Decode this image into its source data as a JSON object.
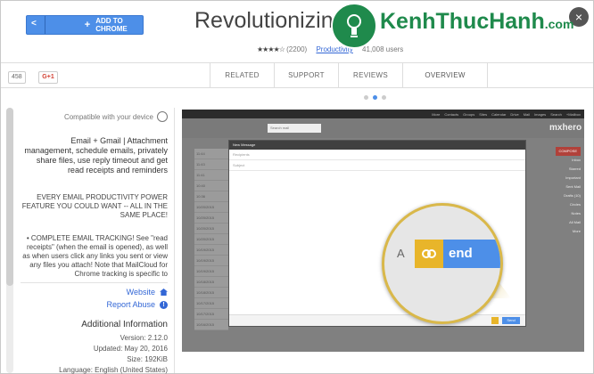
{
  "header": {
    "title": "Revolutionizing...",
    "add_button_label": "ADD TO CHROME",
    "rating_count": "(2200)",
    "category": "Productivity",
    "users": "41,008 users"
  },
  "share": {
    "count": "458",
    "gplus_label": "G+1"
  },
  "tabs": [
    "OVERVIEW",
    "REVIEWS",
    "SUPPORT",
    "RELATED"
  ],
  "sidebar": {
    "compatible": "Compatible with your device",
    "desc_main": "Email + Gmail | Attachment management, schedule emails, privately share files, use reply timeout and get read receipts and reminders",
    "desc_upper": "EVERY EMAIL PRODUCTIVITY POWER FEATURE YOU COULD WANT -- ALL IN THE SAME PLACE!",
    "desc_long": "• COMPLETE EMAIL TRACKING! See \"read receipts\" (when the email is opened), as well as when users click any links you sent or view any files you attach! Note that MailCloud for Chrome tracking is specific to",
    "website": "Website",
    "report_abuse": "Report Abuse",
    "info_title": "Additional Information",
    "version": "Version: 2.12.0",
    "updated": "Updated: May 20, 2016",
    "size": "Size: 192KiB",
    "language": "Language: English (United States)"
  },
  "shot": {
    "brand": "mxhero",
    "topbar": [
      "+Mailbox",
      "Search",
      "Images",
      "Mail",
      "Drive",
      "Calendar",
      "Sites",
      "Groups",
      "Contacts",
      "More"
    ],
    "search": "Search mail",
    "compose_title": "New Message",
    "compose_to": "Recipients",
    "compose_subject": "Subject",
    "send_small": "Send",
    "lens_send": "end",
    "lens_font": "A",
    "nav_compose": "COMPOSE",
    "nav": [
      "Inbox",
      "Starred",
      "Important",
      "Sent Mail",
      "Drafts (10)",
      "Circles",
      "Notes",
      "All Mail",
      "More"
    ],
    "rows": [
      "11:44",
      "11:43",
      "11:41",
      "10:40",
      "10:36",
      "10/20/2015",
      "10/20/2015",
      "10/20/2015",
      "10/20/2015",
      "10/19/2015",
      "10/19/2015",
      "10/19/2015",
      "10/18/2015",
      "10/18/2015",
      "10/17/2015",
      "10/17/2015",
      "10/16/2015"
    ]
  },
  "watermark": {
    "brand": "KenhThucHanh",
    "suffix": ".com"
  },
  "colors": {
    "accent": "#4d8fe8",
    "track": "#e8b52a",
    "link": "#3367d6",
    "watermark": "#1f8a4c"
  }
}
